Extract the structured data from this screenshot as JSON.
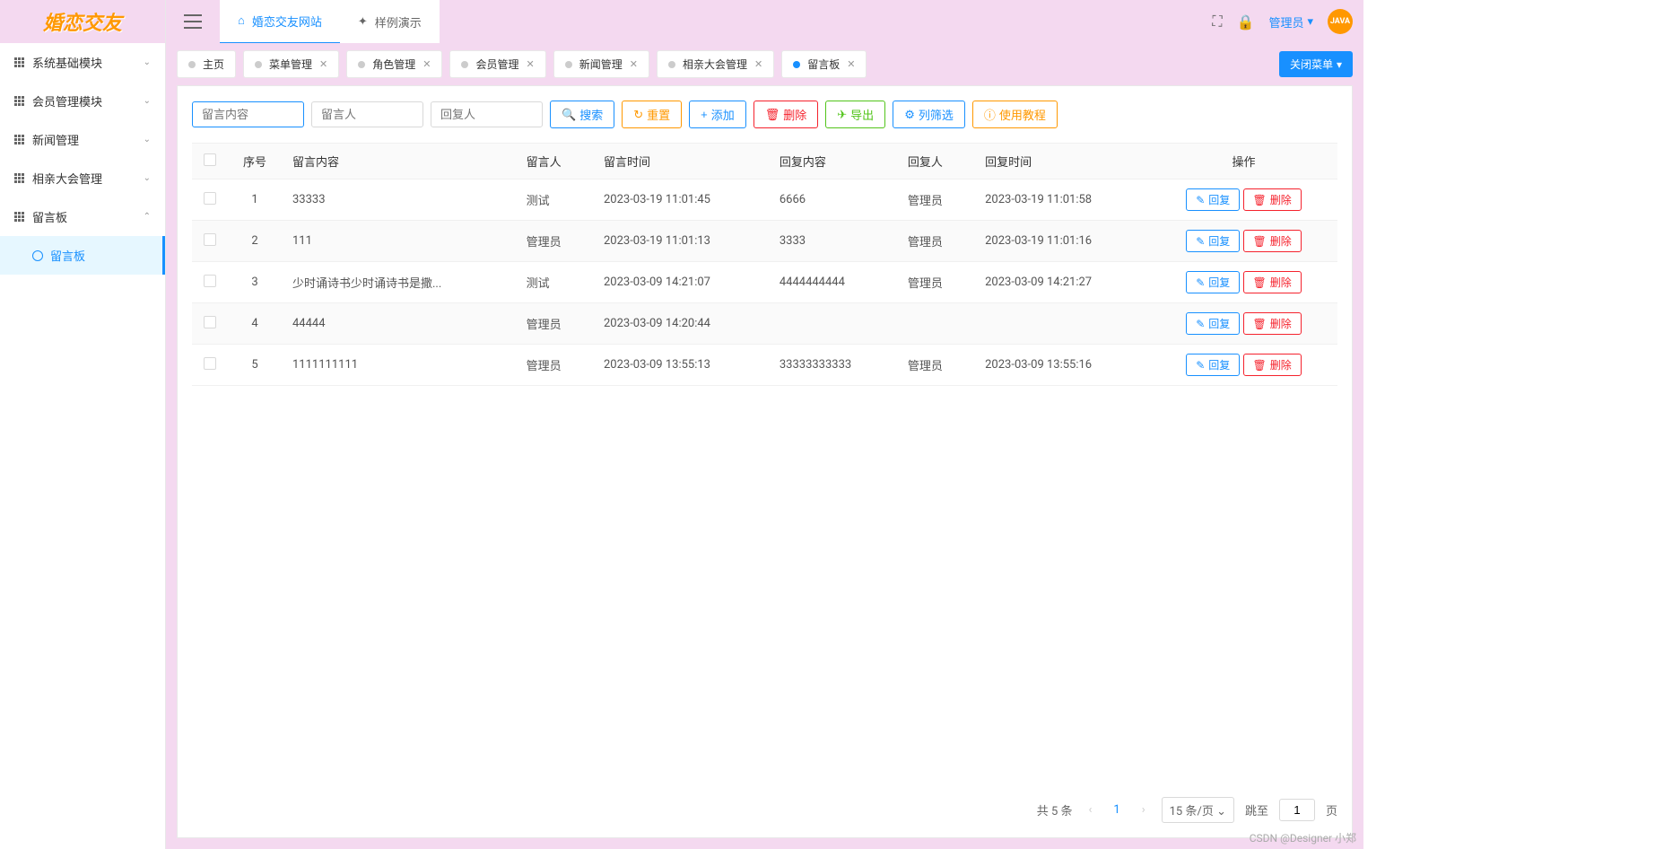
{
  "logo": "婚恋交友",
  "sidebar": {
    "items": [
      {
        "label": "系统基础模块",
        "expanded": false
      },
      {
        "label": "会员管理模块",
        "expanded": false
      },
      {
        "label": "新闻管理",
        "expanded": false
      },
      {
        "label": "相亲大会管理",
        "expanded": false
      },
      {
        "label": "留言板",
        "expanded": true
      }
    ],
    "submenu": {
      "label": "留言板"
    }
  },
  "header": {
    "top_tabs": [
      {
        "label": "婚恋交友网站",
        "active": true
      },
      {
        "label": "样例演示",
        "active": false
      }
    ],
    "admin_label": "管理员",
    "avatar_text": "JAVA"
  },
  "tabs": [
    {
      "label": "主页",
      "active": false,
      "closable": false
    },
    {
      "label": "菜单管理",
      "active": false,
      "closable": true
    },
    {
      "label": "角色管理",
      "active": false,
      "closable": true
    },
    {
      "label": "会员管理",
      "active": false,
      "closable": true
    },
    {
      "label": "新闻管理",
      "active": false,
      "closable": true
    },
    {
      "label": "相亲大会管理",
      "active": false,
      "closable": true
    },
    {
      "label": "留言板",
      "active": true,
      "closable": true
    }
  ],
  "close_menu_label": "关闭菜单",
  "toolbar": {
    "search_content_placeholder": "留言内容",
    "search_person_placeholder": "留言人",
    "search_reply_placeholder": "回复人",
    "search_label": "搜索",
    "reset_label": "重置",
    "add_label": "添加",
    "delete_label": "删除",
    "export_label": "导出",
    "columns_label": "列筛选",
    "tutorial_label": "使用教程"
  },
  "table": {
    "headers": {
      "index": "序号",
      "content": "留言内容",
      "person": "留言人",
      "time": "留言时间",
      "reply_content": "回复内容",
      "reply_person": "回复人",
      "reply_time": "回复时间",
      "action": "操作"
    },
    "action_labels": {
      "reply": "回复",
      "delete": "删除"
    },
    "rows": [
      {
        "index": "1",
        "content": "33333",
        "person": "测试",
        "time": "2023-03-19 11:01:45",
        "reply_content": "6666",
        "reply_person": "管理员",
        "reply_time": "2023-03-19 11:01:58"
      },
      {
        "index": "2",
        "content": "111",
        "person": "管理员",
        "time": "2023-03-19 11:01:13",
        "reply_content": "3333",
        "reply_person": "管理员",
        "reply_time": "2023-03-19 11:01:16"
      },
      {
        "index": "3",
        "content": "少时诵诗书少时诵诗书是撒...",
        "person": "测试",
        "time": "2023-03-09 14:21:07",
        "reply_content": "4444444444",
        "reply_person": "管理员",
        "reply_time": "2023-03-09 14:21:27"
      },
      {
        "index": "4",
        "content": "44444",
        "person": "管理员",
        "time": "2023-03-09 14:20:44",
        "reply_content": "",
        "reply_person": "",
        "reply_time": ""
      },
      {
        "index": "5",
        "content": "1111111111",
        "person": "管理员",
        "time": "2023-03-09 13:55:13",
        "reply_content": "33333333333",
        "reply_person": "管理员",
        "reply_time": "2023-03-09 13:55:16"
      }
    ]
  },
  "pagination": {
    "total_label": "共 5 条",
    "current_page": "1",
    "page_size_label": "15 条/页",
    "jump_label": "跳至",
    "jump_value": "1",
    "page_suffix": "页"
  },
  "watermark": "CSDN @Designer 小郑"
}
